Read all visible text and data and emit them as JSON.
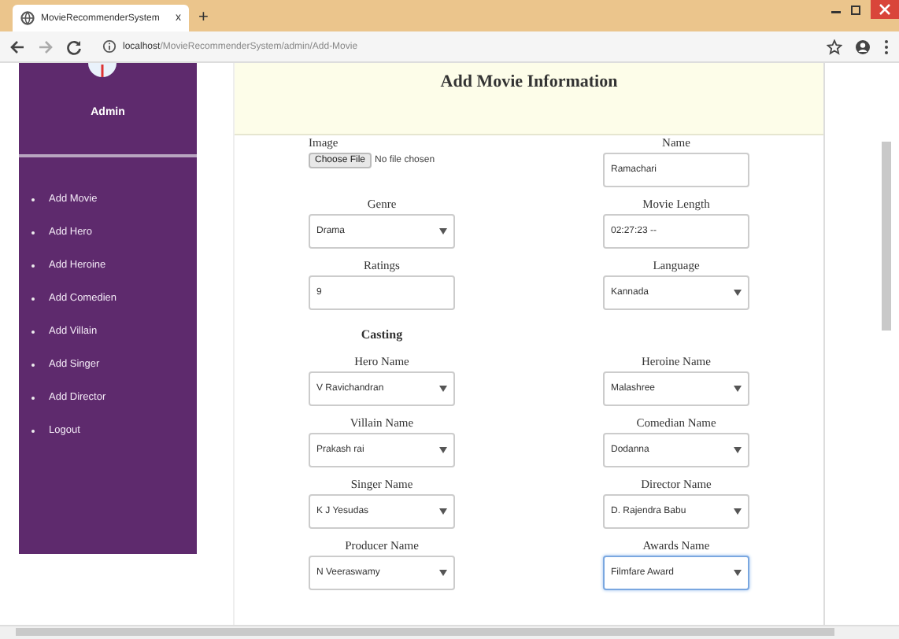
{
  "browser": {
    "tab_title": "MovieRecommenderSystem",
    "tab_close": "x",
    "new_tab": "+",
    "url_host": "localhost",
    "url_path": "/MovieRecommenderSystem/admin/Add-Movie"
  },
  "sidebar": {
    "user": "Admin",
    "items": [
      {
        "label": "Add Movie"
      },
      {
        "label": "Add Hero"
      },
      {
        "label": "Add Heroine"
      },
      {
        "label": "Add Comedien"
      },
      {
        "label": "Add Villain"
      },
      {
        "label": "Add Singer"
      },
      {
        "label": "Add Director"
      },
      {
        "label": "Logout"
      }
    ]
  },
  "page_title": "Add Movie Information",
  "form": {
    "sections": [
      {
        "fields": [
          {
            "kind": "file",
            "label": "Image",
            "button": "Choose File",
            "value": "No file chosen"
          },
          {
            "kind": "text",
            "label": "Name",
            "value": "Ramachari",
            "focused": false
          },
          {
            "kind": "select",
            "label": "Genre",
            "value": "Drama",
            "focused": false
          },
          {
            "kind": "text",
            "label": "Movie Length",
            "value": "02:27:23 --",
            "focused": false
          },
          {
            "kind": "text",
            "label": "Ratings",
            "value": "9",
            "focused": false
          },
          {
            "kind": "select",
            "label": "Language",
            "value": "Kannada",
            "focused": false
          }
        ]
      },
      {
        "heading": "Casting",
        "fields": [
          {
            "kind": "select",
            "label": "Hero Name",
            "value": "V Ravichandran",
            "focused": false
          },
          {
            "kind": "select",
            "label": "Heroine Name",
            "value": "Malashree",
            "focused": false
          },
          {
            "kind": "select",
            "label": "Villain Name",
            "value": "Prakash rai",
            "focused": false
          },
          {
            "kind": "select",
            "label": "Comedian Name",
            "value": "Dodanna",
            "focused": false
          },
          {
            "kind": "select",
            "label": "Singer Name",
            "value": "K J Yesudas",
            "focused": false
          },
          {
            "kind": "select",
            "label": "Director Name",
            "value": "D. Rajendra Babu",
            "focused": false
          },
          {
            "kind": "select",
            "label": "Producer Name",
            "value": "N Veeraswamy",
            "focused": false
          },
          {
            "kind": "select",
            "label": "Awards Name",
            "value": "Filmfare Award",
            "focused": true
          }
        ]
      }
    ]
  }
}
